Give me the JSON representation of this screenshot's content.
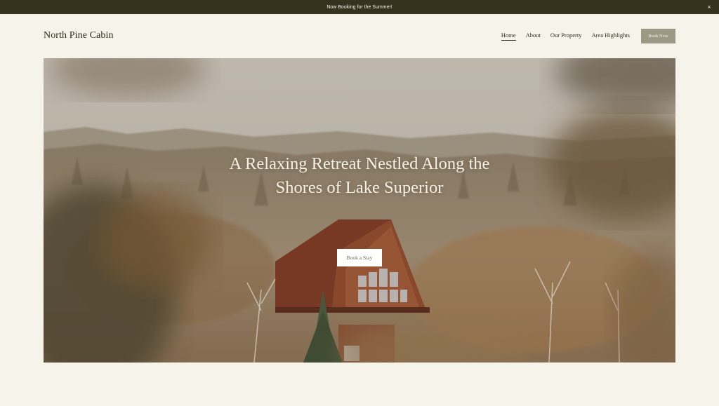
{
  "announcement": {
    "text": "Now Booking for the Summer!",
    "close_glyph": "×"
  },
  "header": {
    "site_title": "North Pine Cabin",
    "nav": [
      {
        "label": "Home",
        "active": true
      },
      {
        "label": "About",
        "active": false
      },
      {
        "label": "Our Property",
        "active": false
      },
      {
        "label": "Area Highlights",
        "active": false
      }
    ],
    "book_button": "Book Now"
  },
  "hero": {
    "title_line1": "A Relaxing Retreat Nestled Along the",
    "title_line2": "Shores of Lake Superior",
    "cta_label": "Book a Stay"
  },
  "colors": {
    "announcement_bg": "#37321d",
    "page_bg": "#f5f3ea",
    "book_button_bg": "#9c9a84",
    "cabin_roof": "#7d3a24"
  }
}
